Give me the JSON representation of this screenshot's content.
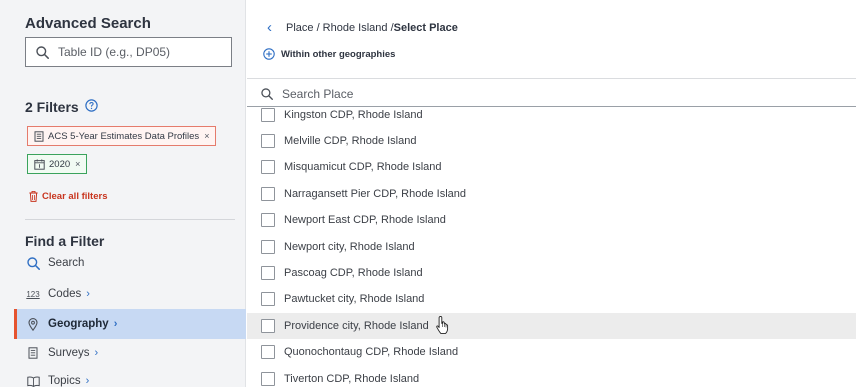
{
  "sidebar": {
    "title": "Advanced Search",
    "search_placeholder": "Table ID (e.g., DP05)",
    "filters_heading": "2 Filters",
    "chips": [
      {
        "label": "ACS 5-Year Estimates Data Profiles",
        "close": "×"
      },
      {
        "label": "2020",
        "close": "×"
      }
    ],
    "clear_label": "Clear all filters",
    "find_heading": "Find a Filter",
    "nav": [
      {
        "label": "Search",
        "chevron": ""
      },
      {
        "label": "Codes",
        "chevron": "›"
      },
      {
        "label": "Geography",
        "chevron": "›"
      },
      {
        "label": "Surveys",
        "chevron": "›"
      },
      {
        "label": "Topics",
        "chevron": "›"
      }
    ],
    "codes_icon_text": "123"
  },
  "main": {
    "breadcrumb": {
      "back": "‹",
      "path": "Place / Rhode Island / ",
      "current": "Select Place"
    },
    "within_label": "Within other geographies",
    "search_placeholder": "Search Place",
    "places": [
      "Kingston CDP, Rhode Island",
      "Melville CDP, Rhode Island",
      "Misquamicut CDP, Rhode Island",
      "Narragansett Pier CDP, Rhode Island",
      "Newport East CDP, Rhode Island",
      "Newport city, Rhode Island",
      "Pascoag CDP, Rhode Island",
      "Pawtucket city, Rhode Island",
      "Providence city, Rhode Island",
      "Quonochontaug CDP, Rhode Island",
      "Tiverton CDP, Rhode Island"
    ]
  },
  "colors": {
    "accent_blue": "#2f6fc4",
    "active_bg": "#c7d9f3",
    "active_marker": "#e5532f",
    "clear_red": "#c8351f",
    "chip_red_border": "#e57b6c",
    "chip_green_border": "#3aa35c"
  },
  "icons": {
    "search": "search-icon",
    "help": "help-circle-icon",
    "survey_chip": "document-icon",
    "year_chip": "calendar-icon",
    "clear": "trash-icon",
    "codes": "numbers-icon",
    "geography": "map-pin-icon",
    "surveys": "document-icon",
    "topics": "book-icon",
    "within": "plus-circle-icon",
    "back": "chevron-left-icon",
    "cursor": "hand-pointer-icon"
  }
}
